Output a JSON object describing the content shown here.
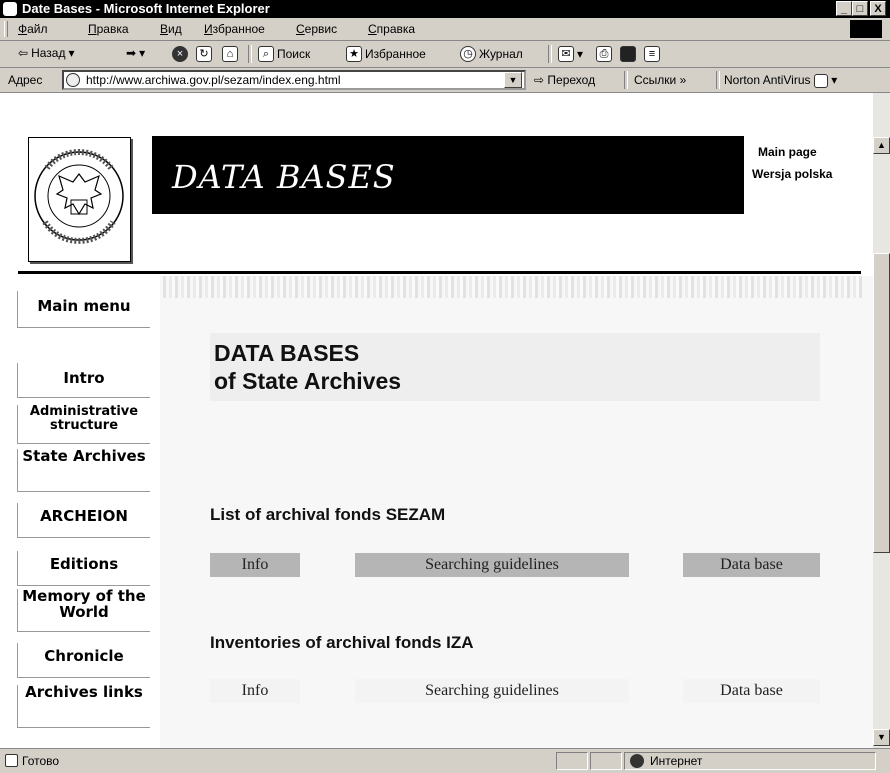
{
  "window": {
    "title": "Date Bases - Microsoft Internet Explorer",
    "controls": {
      "minimize": "_",
      "maximize": "□",
      "close": "X"
    }
  },
  "menu": [
    "Файл",
    "Правка",
    "Вид",
    "Избранное",
    "Сервис",
    "Справка"
  ],
  "toolbar": {
    "back": "Назад",
    "search": "Поиск",
    "favorites": "Избранное",
    "history": "Журнал"
  },
  "address": {
    "label": "Адрес",
    "url": "http://www.archiwa.gov.pl/sezam/index.eng.html",
    "go": "Переход",
    "links": "Ссылки",
    "links_chevron": "»",
    "norton": "Norton AntiVirus"
  },
  "page": {
    "banner_title": "DATA BASES",
    "top_links": [
      "Main page",
      "Wersja polska"
    ],
    "nav": [
      "Main menu",
      "Intro",
      "Administrative structure",
      "State Archives",
      "ARCHEION",
      "Editions",
      "Memory of the World",
      "Chronicle",
      "Archives links"
    ],
    "heading_line1": "DATA BASES",
    "heading_line2": "of State Archives",
    "sections": [
      {
        "title": "List of archival fonds SEZAM",
        "buttons": [
          "Info",
          "Searching guidelines",
          "Data base"
        ]
      },
      {
        "title": "Inventories of archival fonds IZA",
        "buttons": [
          "Info",
          "Searching guidelines",
          "Data base"
        ]
      }
    ],
    "logo_text": "NACZELNA DYREKCJA ARCHIWÓW PAŃSTWOWYCH"
  },
  "status": {
    "text": "Готово",
    "zone": "Интернет"
  },
  "colors": {
    "banner_bg": "#000000",
    "nav_button_gray": "#b5b5b5",
    "heading_box": "#eeeeee"
  }
}
